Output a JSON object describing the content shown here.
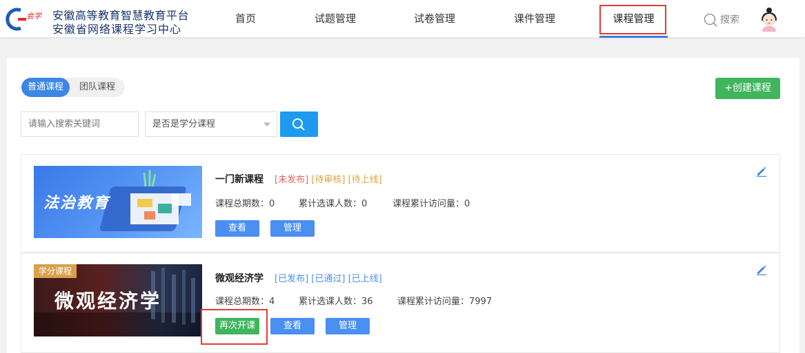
{
  "header": {
    "logo_line1": "安徽高等教育智慧教育平台",
    "logo_line2": "安徽省网络课程学习中心",
    "nav": [
      "首页",
      "试题管理",
      "试卷管理",
      "课件管理",
      "课程管理"
    ],
    "active_nav": "课程管理",
    "search_label": "搜索"
  },
  "tabs": [
    "普通课程",
    "团队课程"
  ],
  "active_tab": "普通课程",
  "create_button": "+创建课程",
  "search": {
    "placeholder": "请输入搜索关键词",
    "select_value": "是否是学分课程"
  },
  "courses": [
    {
      "thumb_text": "法治教育",
      "title": "一门新课程",
      "statuses": [
        "[未发布]",
        "[待审核]",
        "[待上线]"
      ],
      "status_colors": [
        "#e06464",
        "#e0a23a",
        "#e0a23a"
      ],
      "stats": [
        "课程总期数：0",
        "累计选课人数：0",
        "课程累计访问量：0"
      ],
      "buttons": [
        "查看",
        "管理"
      ]
    },
    {
      "badge": "学分课程",
      "thumb_text": "微观经济学",
      "title": "微观经济学",
      "statuses": [
        "[已发布]",
        "[已通过]",
        "[已上线]"
      ],
      "status_colors": [
        "#4a8ff2",
        "#4a8ff2",
        "#4a8ff2"
      ],
      "stats": [
        "课程总期数：4",
        "累计选课人数：36",
        "课程累计访问量：7997"
      ],
      "buttons": [
        "再次开课",
        "查看",
        "管理"
      ]
    }
  ],
  "colors": {
    "primary": "#3c86e4",
    "success": "#3fb55d",
    "search_button": "#1e9bf0",
    "highlight": "#e53935"
  }
}
